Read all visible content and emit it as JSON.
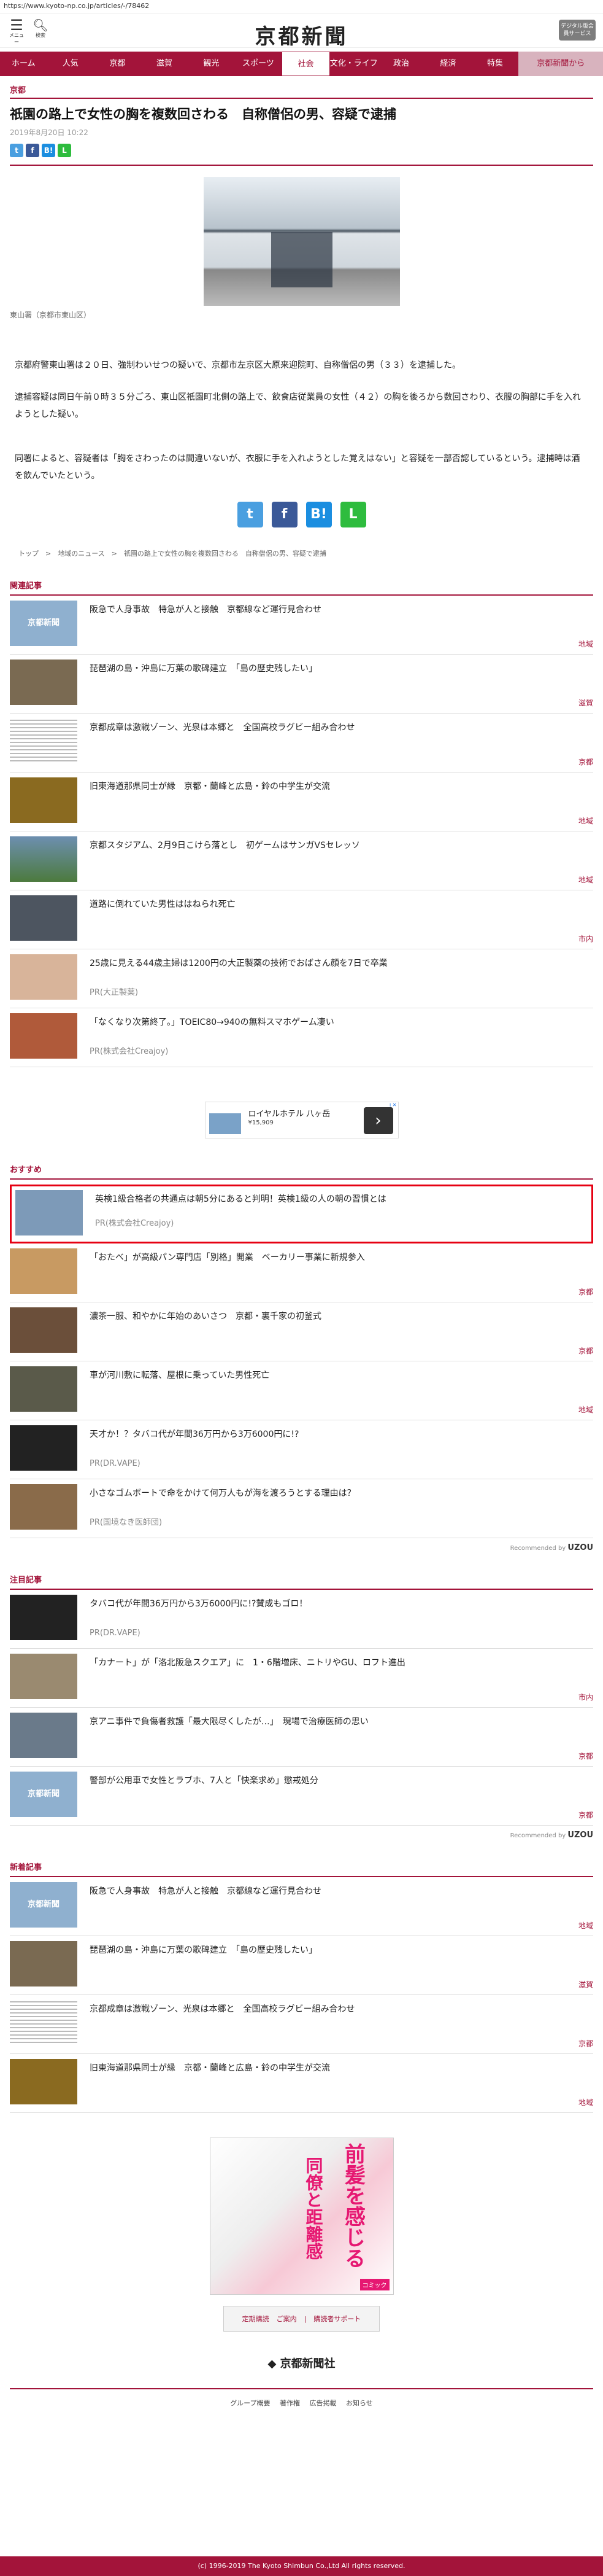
{
  "url": "https://www.kyoto-np.co.jp/articles/-/78462",
  "topbar": {
    "menu_label": "メニュー",
    "search_label": "検索",
    "logo": "京都新聞",
    "digital_button": "デジタル版会員サービス"
  },
  "nav": [
    "ホーム",
    "人気",
    "京都",
    "滋賀",
    "観光",
    "スポーツ",
    "社会",
    "文化・ライフ",
    "政治",
    "経済",
    "特集",
    "京都新聞から"
  ],
  "article": {
    "section": "京都",
    "title": "祇園の路上で女性の胸を複数回さわる　自称僧侶の男、容疑で逮捕",
    "date": "2019年8月20日 10:22",
    "caption": "東山署（京都市東山区）",
    "p1": "京都府警東山署は２０日、強制わいせつの疑いで、京都市左京区大原来迎院町、自称僧侶の男（３３）を逮捕した。",
    "p2": "逮捕容疑は同日午前０時３５分ごろ、東山区祇園町北側の路上で、飲食店従業員の女性（４２）の胸を後ろから数回さわり、衣服の胸部に手を入れようとした疑い。",
    "p3": "同署によると、容疑者は「胸をさわったのは間違いないが、衣服に手を入れようとした覚えはない」と容疑を一部否認しているという。逮捕時は酒を飲んでいたという。"
  },
  "breadcrumbs": "トップ　>　地域のニュース　>　祇園の路上で女性の胸を複数回さわる　自称僧侶の男、容疑で逮捕",
  "related": {
    "heading": "関連記事",
    "items": [
      {
        "text": "阪急で人身事故　特急が人と接触　京都線など運行見合わせ",
        "tag": "地域"
      },
      {
        "text": "琵琶湖の島・沖島に万葉の歌碑建立　「島の歴史残したい」",
        "tag": "滋賀"
      },
      {
        "text": "京都成章は激戦ゾーン、光泉は本郷と　全国高校ラグビー組み合わせ",
        "tag": "京都"
      },
      {
        "text": "旧東海道那県同士が縁　京都・蘭峰と広島・鈴の中学生が交流",
        "tag": "地域"
      },
      {
        "text": "京都スタジアム、2月9日こけら落とし　初ゲームはサンガVSセレッソ",
        "tag": "地域"
      },
      {
        "text": "道路に倒れていた男性ははねられ死亡",
        "tag": "市内"
      },
      {
        "text": "25歳に見える44歳主婦は1200円の大正製薬の技術でおばさん顔を7日で卒業",
        "pr": "PR(大正製薬)"
      },
      {
        "text": "「なくなり次第終了。」TOEIC80→940の無料スマホゲーム凄い",
        "pr": "PR(株式会社Creajoy)"
      }
    ]
  },
  "ad": {
    "title": "ロイヤルホテル 八ヶ岳",
    "price": "¥15,909",
    "arrow": "›",
    "badge": "i ✕"
  },
  "recommend": {
    "heading": "おすすめ",
    "items": [
      {
        "text": "英検1級合格者の共通点は朝5分にあると判明！英検1級の人の朝の習慣とは",
        "pr": "PR(株式会社Creajoy)"
      },
      {
        "text": "「おたべ」が高級パン専門店「別格」開業　ベーカリー事業に新規参入",
        "tag": "京都"
      },
      {
        "text": "濃茶一服、和やかに年始のあいさつ　京都・裏千家の初釜式",
        "tag": "京都"
      },
      {
        "text": "車が河川敷に転落、屋根に乗っていた男性死亡",
        "tag": "地域"
      },
      {
        "text": "天才か！？タバコ代が年間36万円から3万6000円に!?",
        "pr": "PR(DR.VAPE)"
      },
      {
        "text": "小さなゴムボートで命をかけて何万人もが海を渡ろうとする理由は？",
        "pr": "PR(国境なき医師団)"
      }
    ],
    "recommended_by": "Recommended by",
    "uzou": "UZOU"
  },
  "attention": {
    "heading": "注目記事",
    "items": [
      {
        "text": "タバコ代が年間36万円から3万6000円に!?賛成もゴロ！",
        "pr": "PR(DR.VAPE)"
      },
      {
        "text": "「カナート」が「洛北阪急スクエア」に　1・6階増床、ニトリやGU、ロフト進出",
        "tag": "市内"
      },
      {
        "text": "京アニ事件で負傷者救護「最大限尽くしたが…」　現場で治療医師の思い",
        "tag": "京都"
      },
      {
        "text": "警部が公用車で女性とラブホ、7人と「快楽求め」懲戒処分",
        "tag": "京都"
      }
    ],
    "recommended_by": "Recommended by",
    "uzou": "UZOU"
  },
  "newest": {
    "heading": "新着記事",
    "items": [
      {
        "text": "阪急で人身事故　特急が人と接触　京都線など運行見合わせ",
        "tag": "地域"
      },
      {
        "text": "琵琶湖の島・沖島に万葉の歌碑建立　「島の歴史残したい」",
        "tag": "滋賀"
      },
      {
        "text": "京都成章は激戦ゾーン、光泉は本郷と　全国高校ラグビー組み合わせ",
        "tag": "京都"
      },
      {
        "text": "旧東海道那県同士が縁　京都・蘭峰と広島・鈴の中学生が交流",
        "tag": "地域"
      }
    ]
  },
  "manga": {
    "text1": "前髪を感じる",
    "text2": "同僚と距離感",
    "badge": "コミック"
  },
  "footer": {
    "pill": [
      "定期購読",
      "ご案内",
      "|",
      "購読者サポート"
    ],
    "logo": "京都新聞社",
    "links": [
      "グループ概要",
      "著作権",
      "広告掲載",
      "お知らせ"
    ],
    "copyright": "(c) 1996-2019 The Kyoto Shimbun Co.,Ltd All rights reserved."
  }
}
